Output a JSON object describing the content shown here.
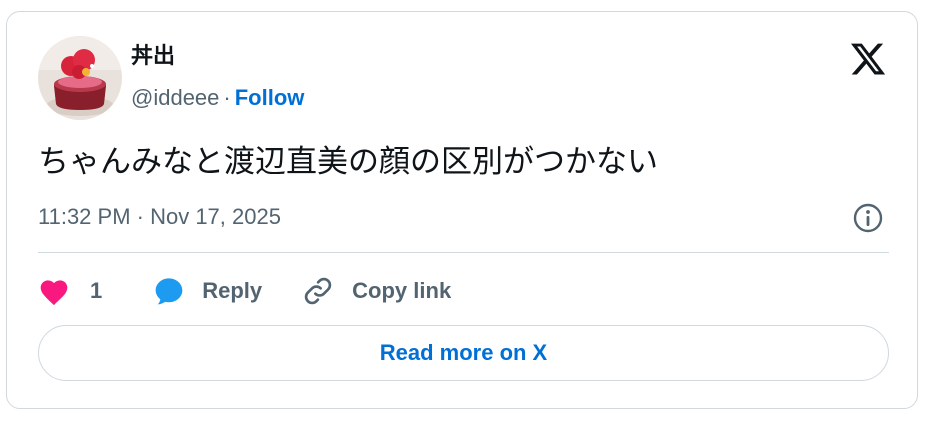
{
  "author": {
    "name": "丼出",
    "handle": "@iddeee",
    "separator": "·",
    "follow_label": "Follow",
    "avatar_icon": "cake-avatar-photo"
  },
  "brand": {
    "logo_icon": "x-logo-icon"
  },
  "tweet": {
    "text": "ちゃんみなと渡辺直美の顔の区別がつかない",
    "timestamp": "11:32 PM · Nov 17, 2025"
  },
  "actions": {
    "like_count": "1",
    "reply_label": "Reply",
    "copy_link_label": "Copy link"
  },
  "read_more_label": "Read more on X",
  "colors": {
    "like": "#f91880",
    "reply": "#1d9bf0",
    "link": "#006fd6",
    "secondary_text": "#536471",
    "border": "#cfd9de"
  }
}
